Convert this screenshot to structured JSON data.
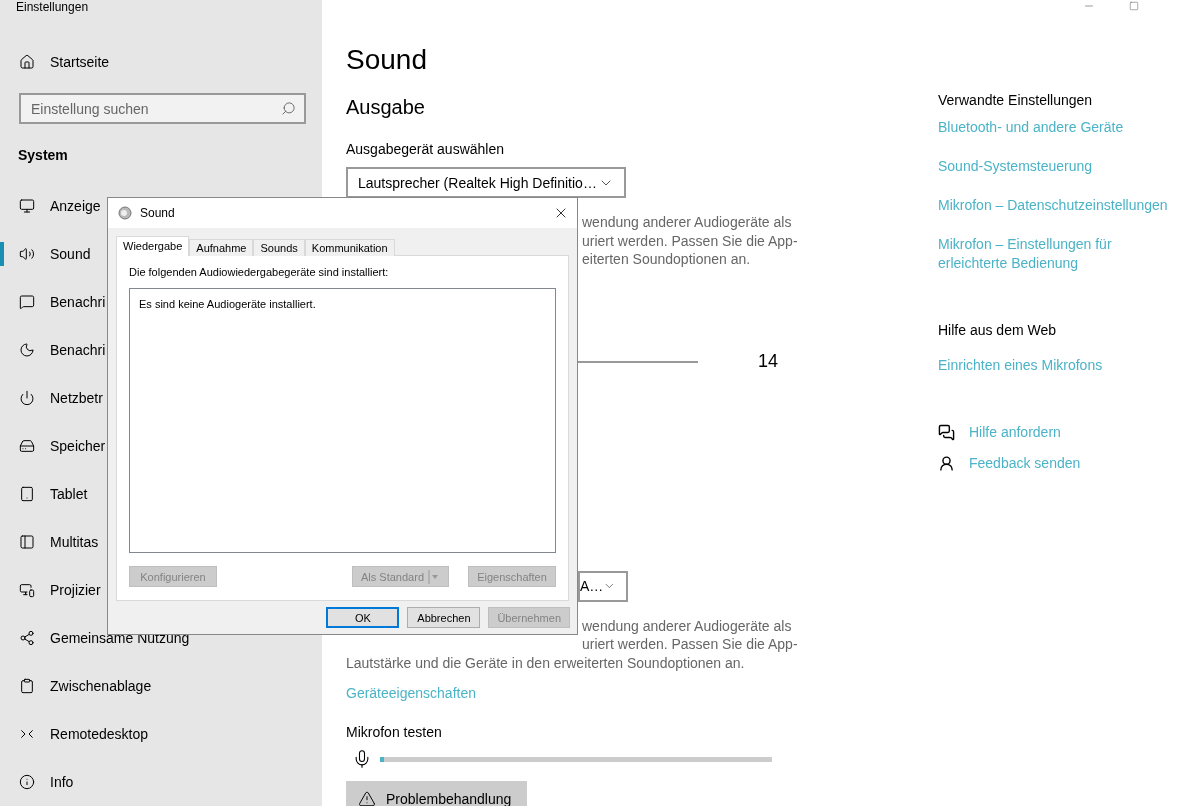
{
  "window": {
    "title": "Einstellungen"
  },
  "sidebar": {
    "home": "Startseite",
    "search": {
      "placeholder": "Einstellung suchen"
    },
    "section": "System",
    "items": [
      {
        "label": "Anzeige",
        "selected": false
      },
      {
        "label": "Sound",
        "selected": true
      },
      {
        "label": "Benachri",
        "selected": false
      },
      {
        "label": "Benachri",
        "selected": false
      },
      {
        "label": "Netzbetr",
        "selected": false
      },
      {
        "label": "Speicher",
        "selected": false
      },
      {
        "label": "Tablet",
        "selected": false
      },
      {
        "label": "Multitas",
        "selected": false
      },
      {
        "label": "Projizier",
        "selected": false
      },
      {
        "label": "Gemeinsame Nutzung",
        "selected": false
      },
      {
        "label": "Zwischenablage",
        "selected": false
      },
      {
        "label": "Remotedesktop",
        "selected": false
      },
      {
        "label": "Info",
        "selected": false
      }
    ]
  },
  "main": {
    "title": "Sound",
    "output": {
      "heading": "Ausgabe",
      "device_label": "Ausgabegerät auswählen",
      "device_value": "Lautsprecher (Realtek High Definitio…",
      "description_fragments": [
        "wendung anderer Audiogeräte als",
        "uriert werden. Passen Sie die App-",
        "eiterten Soundoptionen an."
      ],
      "volume_value": "14"
    },
    "input": {
      "device_value_fragment": "A…",
      "description_fragments": [
        "wendung anderer Audiogeräte als",
        "uriert werden. Passen Sie die App-"
      ],
      "description_line": "Lautstärke und die Geräte in den erweiterten Soundoptionen an.",
      "link": "Geräteeigenschaften",
      "test_label": "Mikrofon testen",
      "meter": {
        "level": 0.01
      },
      "troubleshoot": "Problembehandlung"
    }
  },
  "related": {
    "heading": "Verwandte Einstellungen",
    "links": [
      "Bluetooth- und andere Geräte",
      "Sound-Systemsteuerung",
      "Mikrofon – Datenschutzeinstellungen",
      "Mikrofon – Einstellungen für erleichterte Bedienung"
    ]
  },
  "web_help": {
    "heading": "Hilfe aus dem Web",
    "links": [
      "Einrichten eines Mikrofons"
    ]
  },
  "support": [
    "Hilfe anfordern",
    "Feedback senden"
  ],
  "dialog": {
    "title": "Sound",
    "tabs": [
      {
        "label": "Wiedergabe",
        "selected": true
      },
      {
        "label": "Aufnahme",
        "selected": false
      },
      {
        "label": "Sounds",
        "selected": false
      },
      {
        "label": "Kommunikation",
        "selected": false
      }
    ],
    "caption": "Die folgenden Audiowiedergabegeräte sind installiert:",
    "empty_message": "Es sind keine Audiogeräte installiert.",
    "panel_buttons": [
      {
        "label": "Konfigurieren",
        "kind": "plain",
        "disabled": true
      },
      {
        "label": "Als Standard",
        "kind": "split",
        "disabled": true
      },
      {
        "label": "Eigenschaften",
        "kind": "plain",
        "disabled": true
      }
    ],
    "buttons": [
      {
        "label": "OK",
        "default": true,
        "disabled": false
      },
      {
        "label": "Abbrechen",
        "default": false,
        "disabled": false
      },
      {
        "label": "Übernehmen",
        "default": false,
        "disabled": true
      }
    ]
  }
}
